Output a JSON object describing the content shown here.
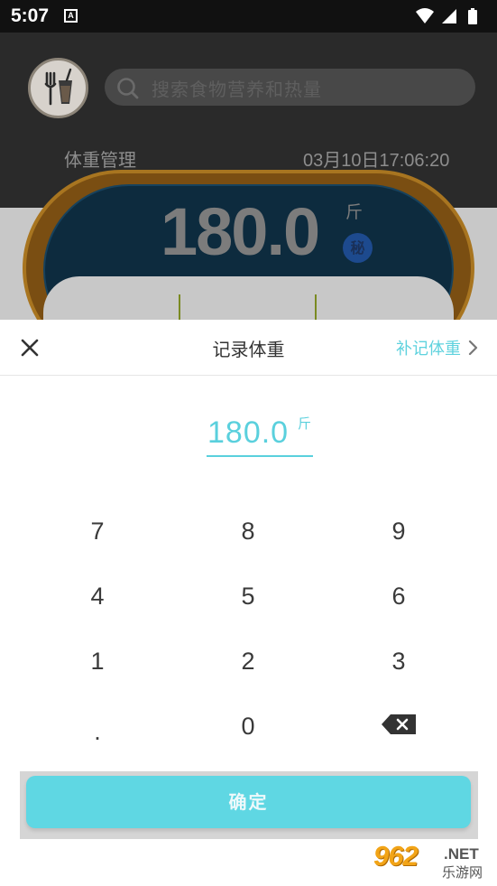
{
  "status_bar": {
    "time": "5:07",
    "notification_icon": "A",
    "icons": [
      "wifi-icon",
      "signal-icon",
      "battery-icon"
    ]
  },
  "background_app": {
    "logo_icon": "fork-and-drink-icon",
    "search_placeholder": "搜索食物营养和热量",
    "section_title": "体重管理",
    "datetime": "03月10日17:06:20",
    "weight": "180.0",
    "unit": "斤",
    "badge": "秘"
  },
  "sheet": {
    "title": "记录体重",
    "backfill_label": "补记体重",
    "weight_value": "180.0",
    "weight_unit": "斤",
    "keypad": [
      [
        "7",
        "8",
        "9"
      ],
      [
        "4",
        "5",
        "6"
      ],
      [
        "1",
        "2",
        "3"
      ],
      [
        ".",
        "0",
        "backspace"
      ]
    ],
    "confirm_label": "确定"
  },
  "watermark": {
    "number": "962",
    "domain": ".NET",
    "site_name": "乐游网"
  },
  "colors": {
    "accent": "#5ad0dd",
    "button": "#5fd7e3",
    "status_bar": "#111111",
    "overlay_dark": "#2a2a2a"
  }
}
